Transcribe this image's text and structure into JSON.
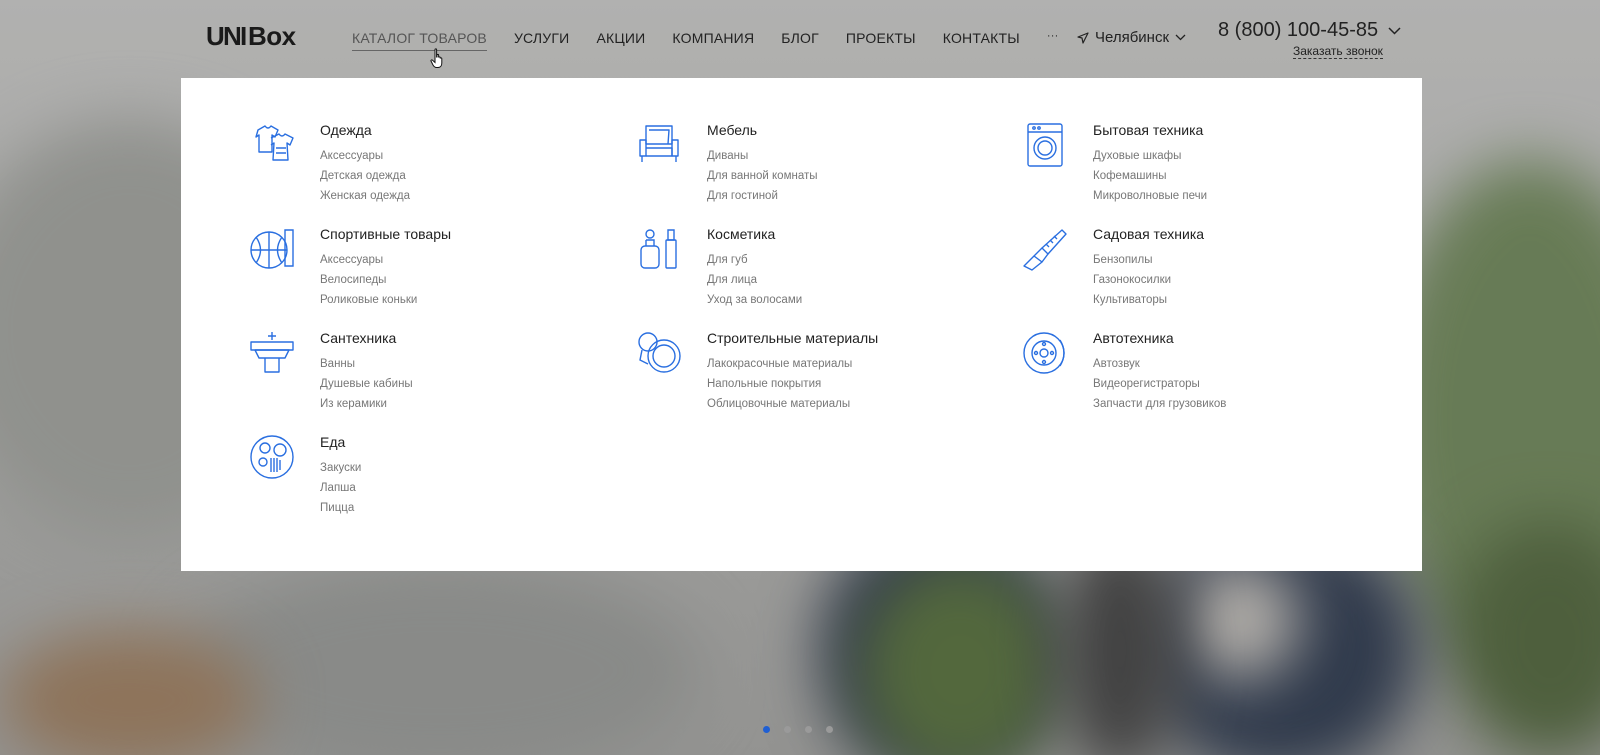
{
  "header": {
    "logo_text": "UNIBox",
    "nav": [
      "КАТАЛОГ ТОВАРОВ",
      "УСЛУГИ",
      "АКЦИИ",
      "КОМПАНИЯ",
      "БЛОГ",
      "ПРОЕКТЫ",
      "КОНТАКТЫ",
      "···"
    ],
    "city": "Челябинск",
    "phone": "8 (800) 100-45-85",
    "callback": "Заказать звонок"
  },
  "catalog": [
    {
      "title": "Одежда",
      "items": [
        "Аксессуары",
        "Детская одежда",
        "Женская одежда"
      ],
      "icon": "clothes-icon"
    },
    {
      "title": "Мебель",
      "items": [
        "Диваны",
        "Для ванной комнаты",
        "Для гостиной"
      ],
      "icon": "armchair-icon"
    },
    {
      "title": "Бытовая техника",
      "items": [
        "Духовые шкафы",
        "Кофемашины",
        "Микроволновые печи"
      ],
      "icon": "washing-machine-icon"
    },
    {
      "title": "Спортивные товары",
      "items": [
        "Аксессуары",
        "Велосипеды",
        "Роликовые коньки"
      ],
      "icon": "basketball-icon"
    },
    {
      "title": "Косметика",
      "items": [
        "Для губ",
        "Для лица",
        "Уход за волосами"
      ],
      "icon": "cosmetics-icon"
    },
    {
      "title": "Садовая техника",
      "items": [
        "Бензопилы",
        "Газонокосилки",
        "Культиваторы"
      ],
      "icon": "chainsaw-icon"
    },
    {
      "title": "Сантехника",
      "items": [
        "Ванны",
        "Душевые кабины",
        "Из керамики"
      ],
      "icon": "sink-icon"
    },
    {
      "title": "Строительные материалы",
      "items": [
        "Лакокрасочные материалы",
        "Напольные покрытия",
        "Облицовочные материалы"
      ],
      "icon": "tape-measure-icon"
    },
    {
      "title": "Автотехника",
      "items": [
        "Автозвук",
        "Видеорегистраторы",
        "Запчасти для грузовиков"
      ],
      "icon": "brake-disc-icon"
    },
    {
      "title": "Еда",
      "items": [
        "Закуски",
        "Лапша",
        "Пицца"
      ],
      "icon": "food-plate-icon"
    }
  ],
  "colors": {
    "accent": "#1f5fd3",
    "icon_stroke": "#2a6fe0"
  },
  "slider": {
    "count": 4,
    "active": 1
  }
}
